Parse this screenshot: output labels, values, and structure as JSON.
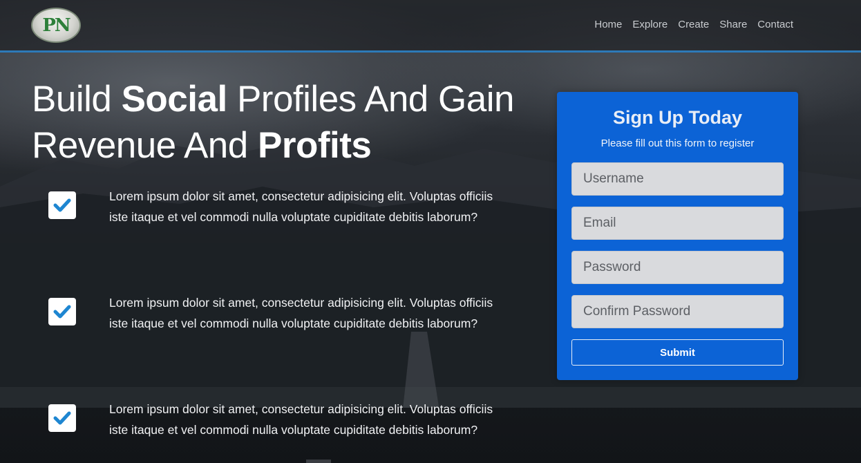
{
  "brand": {
    "logo_text": "PN"
  },
  "nav": [
    "Home",
    "Explore",
    "Create",
    "Share",
    "Contact"
  ],
  "hero": {
    "title_parts": [
      "Build ",
      "Social",
      " Profiles And Gain Revenue And ",
      "Profits"
    ]
  },
  "features": [
    {
      "text": "Lorem ipsum dolor sit amet, consectetur adipisicing elit. Voluptas officiis iste itaque et vel commodi nulla voluptate cupiditate debitis laborum?"
    },
    {
      "text": "Lorem ipsum dolor sit amet, consectetur adipisicing elit. Voluptas officiis iste itaque et vel commodi nulla voluptate cupiditate debitis laborum?"
    },
    {
      "text": "Lorem ipsum dolor sit amet, consectetur adipisicing elit. Voluptas officiis iste itaque et vel commodi nulla voluptate cupiditate debitis laborum?"
    }
  ],
  "signup": {
    "title": "Sign Up Today",
    "subtitle": "Please fill out this form to register",
    "fields": [
      {
        "placeholder": "Username"
      },
      {
        "placeholder": "Email"
      },
      {
        "placeholder": "Password"
      },
      {
        "placeholder": "Confirm Password"
      }
    ],
    "submit_label": "Submit"
  },
  "colors": {
    "accent": "#0c63d6",
    "nav_border": "#2d7ab8",
    "check": "#1e86d1"
  },
  "icons": {
    "feature_icon": "check-icon"
  }
}
